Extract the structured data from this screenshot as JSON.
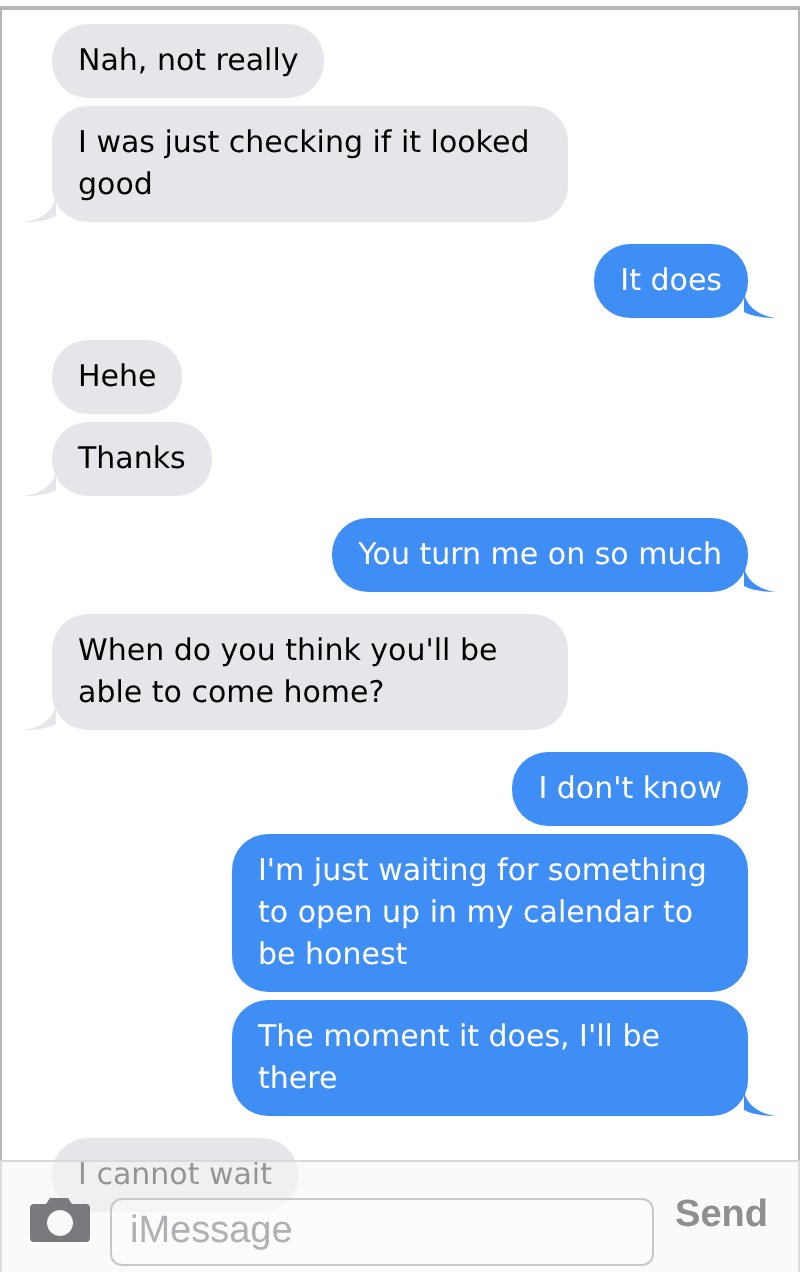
{
  "messages": [
    {
      "text": "Nah, not really",
      "kind": "received",
      "tail": false
    },
    {
      "text": "I was just checking if it looked good",
      "kind": "received",
      "tail": true
    },
    {
      "text": "It does",
      "kind": "sent",
      "tail": true
    },
    {
      "text": "Hehe",
      "kind": "received",
      "tail": false
    },
    {
      "text": "Thanks",
      "kind": "received",
      "tail": true
    },
    {
      "text": "You turn me on so much",
      "kind": "sent",
      "tail": true
    },
    {
      "text": "When do you think you'll be able to come home?",
      "kind": "received",
      "tail": true
    },
    {
      "text": "I don't know",
      "kind": "sent",
      "tail": false
    },
    {
      "text": "I'm just waiting for something to open up in my calendar to be honest",
      "kind": "sent",
      "tail": false
    },
    {
      "text": "The moment it does, I'll be there",
      "kind": "sent",
      "tail": true
    },
    {
      "text": "I cannot wait",
      "kind": "received",
      "tail": false
    }
  ],
  "composer": {
    "placeholder": "iMessage",
    "send": "Send",
    "send_disabled": true
  }
}
